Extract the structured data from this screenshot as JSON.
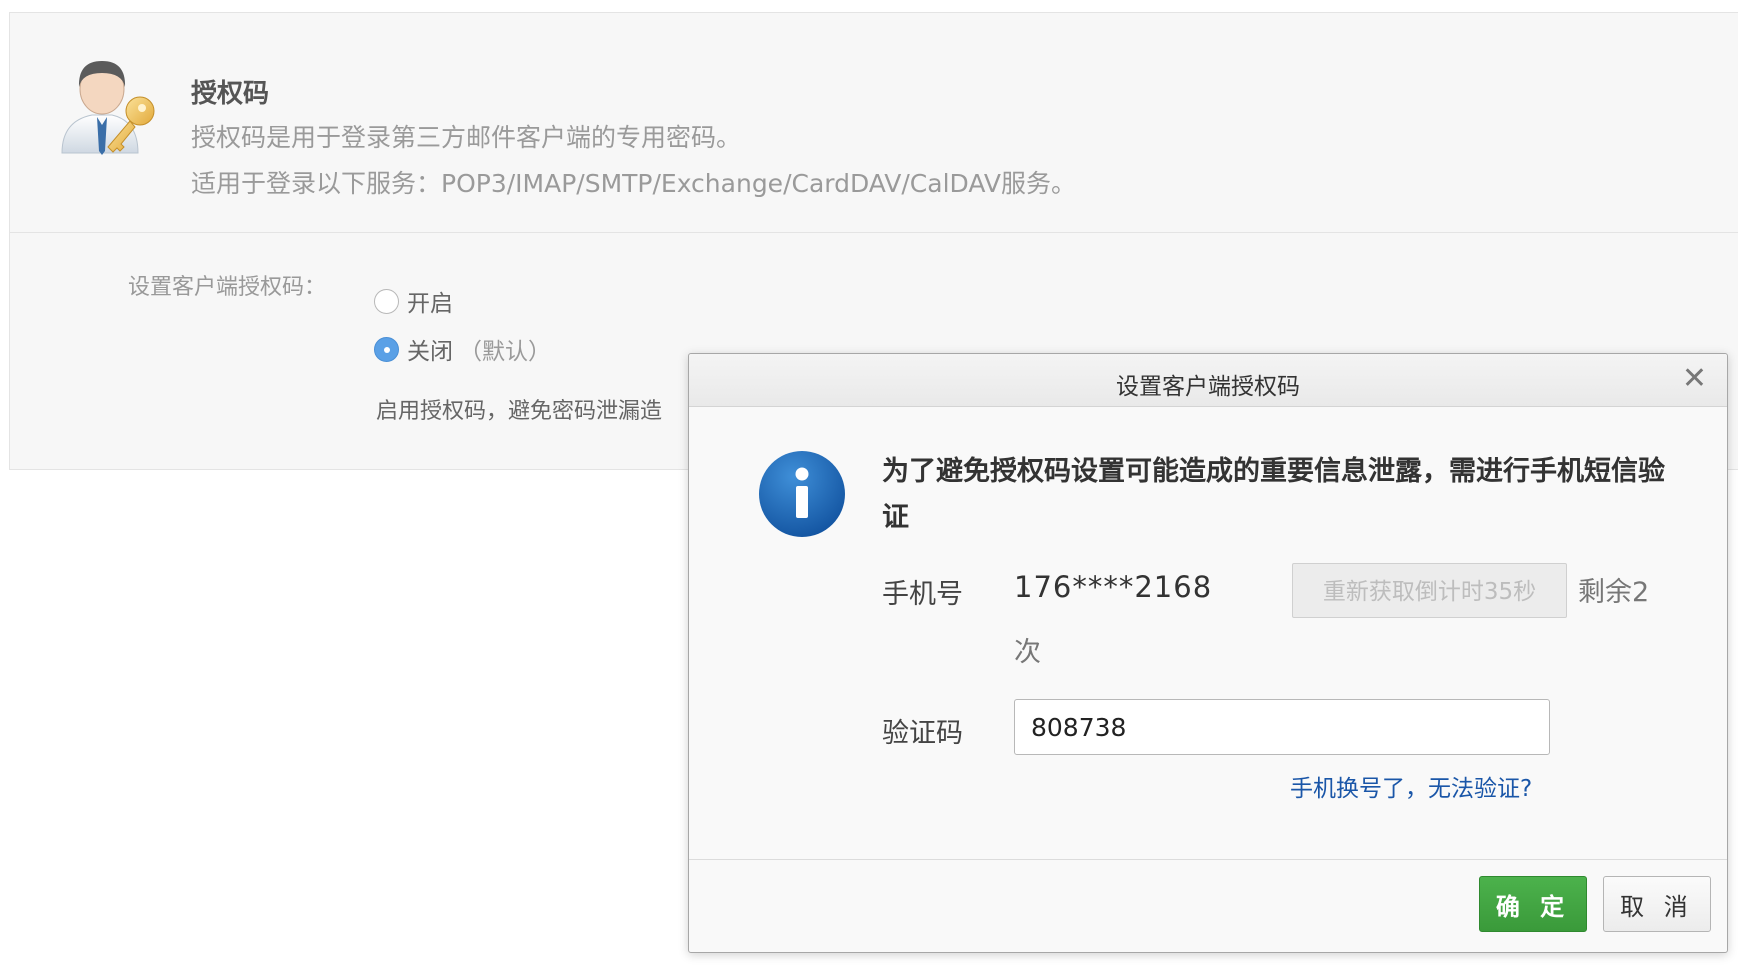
{
  "auth_section": {
    "title": "授权码",
    "description_line1": "授权码是用于登录第三方邮件客户端的专用密码。",
    "description_line2": "适用于登录以下服务：POP3/IMAP/SMTP/Exchange/CardDAV/CalDAV服务。"
  },
  "settings": {
    "label": "设置客户端授权码：",
    "options": [
      {
        "label": "开启",
        "hint": "",
        "selected": false
      },
      {
        "label": "关闭",
        "hint": "（默认）",
        "selected": true
      }
    ],
    "note": "启用授权码，避免密码泄漏造"
  },
  "dialog": {
    "title": "设置客户端授权码",
    "close_icon": "close-icon",
    "info_icon": "info-icon",
    "message": "为了避免授权码设置可能造成的重要信息泄露，需进行手机短信验证",
    "phone_label": "手机号",
    "phone_value": "176****2168",
    "resend_label": "重新获取倒计时35秒",
    "remaining_text": "剩余2",
    "remaining_unit": "次",
    "code_label": "验证码",
    "code_value": "808738",
    "cant_verify_link": "手机换号了，无法验证?",
    "ok_label": "确 定",
    "cancel_label": "取 消"
  },
  "colors": {
    "ok_button": "#3fa53f",
    "link": "#1a56a8",
    "radio_selected": "#5aa0e6",
    "info_icon": "#1760b0"
  }
}
